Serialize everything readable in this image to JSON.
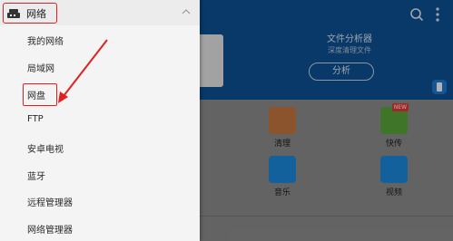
{
  "drawer": {
    "header_label": "网络",
    "items": [
      {
        "label": "我的网络"
      },
      {
        "label": "局域网"
      },
      {
        "label": "网盘"
      },
      {
        "label": "FTP"
      },
      {
        "label": "安卓电视"
      },
      {
        "label": "蓝牙"
      },
      {
        "label": "远程管理器"
      },
      {
        "label": "网络管理器"
      }
    ]
  },
  "analyzer": {
    "title": "文件分析器",
    "subtitle": "深度清理文件",
    "button_label": "分析"
  },
  "tiles": [
    {
      "label": "清理",
      "color": "#c8793f"
    },
    {
      "label": "快传",
      "color": "#5aa83a",
      "badge": "NEW"
    },
    {
      "label": "音乐",
      "color": "#1c8be0"
    },
    {
      "label": "视频",
      "color": "#1c8be0"
    }
  ],
  "colors": {
    "accent_red": "#e02020",
    "app_header_blue": "#0c5296"
  }
}
